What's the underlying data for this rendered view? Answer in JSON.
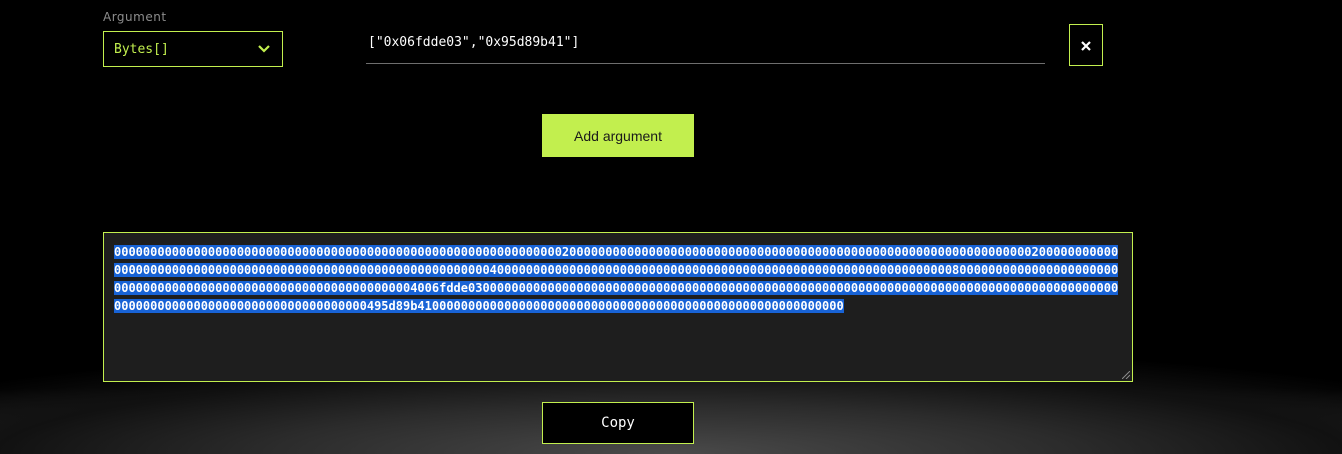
{
  "argument": {
    "label": "Argument",
    "type_selected": "Bytes[]",
    "value": "[\"0x06fdde03\",\"0x95d89b41\"]"
  },
  "icons": {
    "type_dropdown": "chevron-down-icon",
    "remove": "close-icon"
  },
  "add_button_label": "Add argument",
  "output": {
    "encoded": "00000000000000000000000000000000000000000000000000000000000000200000000000000000000000000000000000000000000000000000000000000002000000000000000000000000000000000000000000000000000000000000000400000000000000000000000000000000000000000000000000000000000000080000000000000000000000000000000000000000000000000000000000000004006fdde03000000000000000000000000000000000000000000000000000000000000000000000000000000000000000000000000000000000000000000000000000495d89b41000000000000000000000000000000000000000000000000000000000"
  },
  "copy_button_label": "Copy",
  "colors": {
    "accent": "#c2ef4e",
    "background": "#000000",
    "selection": "#1863d6",
    "textarea_bg": "#1e1e1e"
  }
}
